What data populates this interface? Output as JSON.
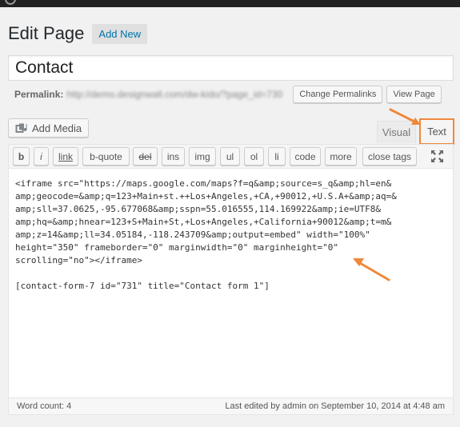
{
  "header": {
    "title": "Edit Page",
    "add_new_label": "Add New"
  },
  "post": {
    "title": "Contact",
    "permalink_label": "Permalink:",
    "permalink_url": "http://demo.designwall.com/dw-kido/?page_id=730",
    "change_permalinks_label": "Change Permalinks",
    "view_page_label": "View Page"
  },
  "media": {
    "add_media_label": "Add Media"
  },
  "editor_tabs": {
    "visual_label": "Visual",
    "text_label": "Text",
    "active": "Text"
  },
  "quicktags": [
    {
      "label": "b"
    },
    {
      "label": "i"
    },
    {
      "label": "link"
    },
    {
      "label": "b-quote"
    },
    {
      "label": "del"
    },
    {
      "label": "ins"
    },
    {
      "label": "img"
    },
    {
      "label": "ul"
    },
    {
      "label": "ol"
    },
    {
      "label": "li"
    },
    {
      "label": "code"
    },
    {
      "label": "more"
    },
    {
      "label": "close tags"
    }
  ],
  "content": {
    "lines": [
      "<iframe src=\"https://maps.google.com/maps?f=q&amp;source=s_q&amp;hl=en&",
      "amp;geocode=&amp;q=123+Main+st.++Los+Angeles,+CA,+90012,+U.S.A+&amp;aq=&",
      "amp;sll=37.0625,-95.677068&amp;sspn=55.016555,114.169922&amp;ie=UTF8&",
      "amp;hq=&amp;hnear=123+S+Main+St,+Los+Angeles,+California+90012&amp;t=m&",
      "amp;z=14&amp;ll=34.05184,-118.243709&amp;output=embed\" width=\"100%\"",
      "height=\"350\" frameborder=\"0\" marginwidth=\"0\" marginheight=\"0\"",
      "scrolling=\"no\"></iframe>",
      "",
      "[contact-form-7 id=\"731\" title=\"Contact form 1\"]"
    ]
  },
  "status": {
    "word_count": "Word count: 4",
    "last_edited": "Last edited by admin on September 10, 2014 at 4:48 am"
  },
  "colors": {
    "highlight": "#f0883a",
    "link": "#0073aa"
  },
  "icons": {
    "add_media": "media-icon",
    "fullscreen": "fullscreen-icon",
    "annotation": "arrow-icon"
  }
}
